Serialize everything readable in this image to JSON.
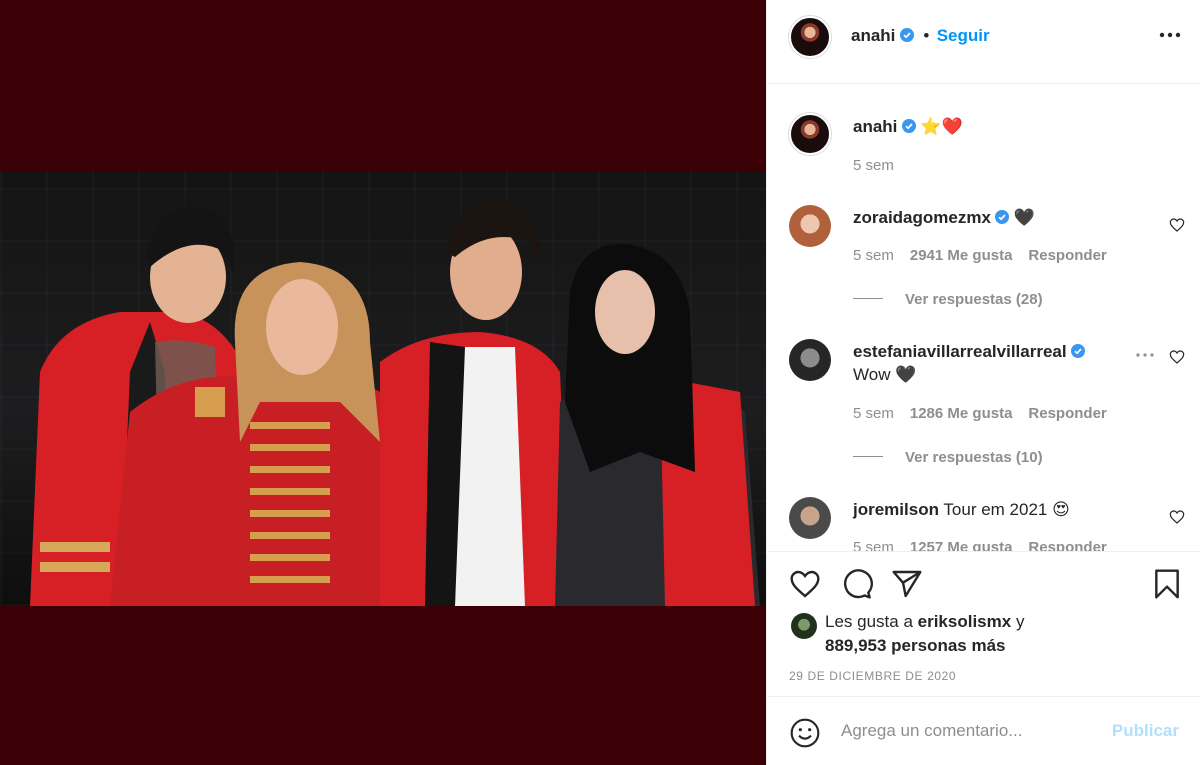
{
  "post": {
    "author": "anahi",
    "follow_label": "Seguir",
    "separator": "•",
    "caption_emoji": "⭐❤️",
    "caption_time": "5 sem"
  },
  "comments": [
    {
      "user": "zoraidagomezmx",
      "text": "🖤",
      "time": "5 sem",
      "likes": "2941 Me gusta",
      "reply": "Responder",
      "view_replies": "Ver respuestas (28)"
    },
    {
      "user": "estefaniavillarrealvillarreal",
      "text": "Wow 🖤",
      "time": "5 sem",
      "likes": "1286 Me gusta",
      "reply": "Responder",
      "view_replies": "Ver respuestas (10)"
    },
    {
      "user": "joremilson",
      "text": "Tour em 2021 😍",
      "time": "5 sem",
      "likes": "1257 Me gusta",
      "reply": "Responder"
    }
  ],
  "likes": {
    "prefix": "Les gusta a",
    "user": "eriksolismx",
    "suffix": "y",
    "count": "889,953 personas más"
  },
  "date": "29 DE DICIEMBRE DE 2020",
  "composer": {
    "placeholder": "Agrega un comentario...",
    "publish": "Publicar"
  },
  "colors": {
    "accent": "#0095f6",
    "media_bg": "#3b0006",
    "jacket_red": "#d71f26"
  },
  "icons": [
    "heart-icon",
    "comment-icon",
    "share-icon",
    "bookmark-icon",
    "emoji-icon",
    "more-icon",
    "verified-icon"
  ]
}
